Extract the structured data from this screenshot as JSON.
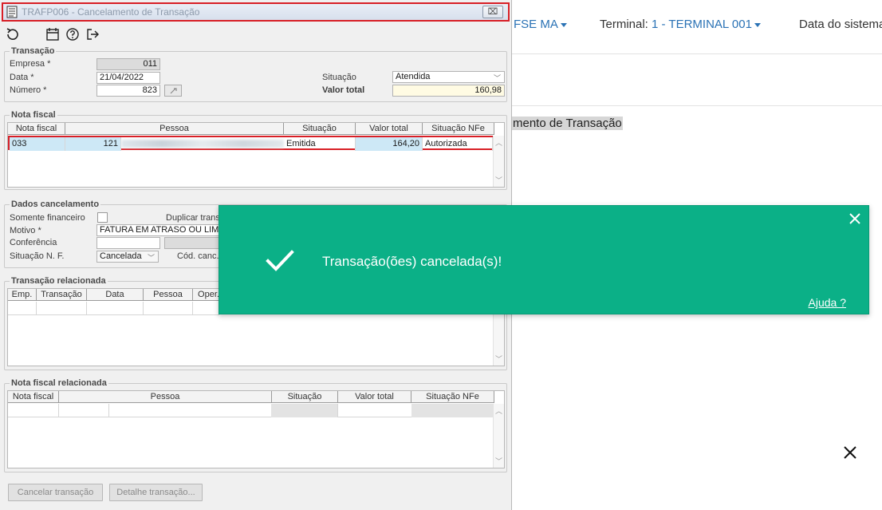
{
  "app": {
    "nav_unit": "FSE MA",
    "terminal_label": "Terminal:",
    "terminal_value": "1 - TERMINAL 001",
    "system_date_label": "Data do sistema",
    "page_title_fragment": "mento de Transação"
  },
  "window": {
    "title": "TRAFP006 - Cancelamento de Transação",
    "close_symbol": "⌧"
  },
  "transacao": {
    "group_title": "Transação",
    "empresa_label": "Empresa *",
    "empresa_value": "011",
    "data_label": "Data *",
    "data_value": "21/04/2022",
    "numero_label": "Número *",
    "numero_value": "823",
    "situacao_label": "Situação",
    "situacao_value": "Atendida",
    "valor_total_label": "Valor total",
    "valor_total_value": "160,98"
  },
  "nota_fiscal": {
    "group_title": "Nota fiscal",
    "columns": [
      "Nota fiscal",
      "Pessoa",
      "Situação",
      "Valor total",
      "Situação NFe"
    ],
    "rows": [
      {
        "nota": "033",
        "pessoa_code": "121",
        "situacao": "Emitida",
        "valor": "164,20",
        "situacao_nfe": "Autorizada"
      }
    ]
  },
  "dados_cancelamento": {
    "group_title": "Dados cancelamento",
    "somente_financeiro_label": "Somente financeiro",
    "duplicar_label": "Duplicar trans",
    "motivo_label": "Motivo *",
    "motivo_value": "FATURA EM ATRASO OU LIMITE",
    "conferencia_label": "Conferência",
    "situacao_nf_label": "Situação N. F.",
    "situacao_nf_value": "Cancelada",
    "cod_canc_label": "Cód. canc."
  },
  "transacao_relacionada": {
    "group_title": "Transação relacionada",
    "columns": [
      "Emp.",
      "Transação",
      "Data",
      "Pessoa",
      "Oper."
    ]
  },
  "nota_fiscal_relacionada": {
    "group_title": "Nota fiscal relacionada",
    "columns": [
      "Nota fiscal",
      "Pessoa",
      "Situação",
      "Valor total",
      "Situação NFe"
    ]
  },
  "buttons": {
    "cancelar": "Cancelar transação",
    "detalhe": "Detalhe transação..."
  },
  "notification": {
    "message": "Transação(ões) cancelada(s)!",
    "help_link": "Ajuda ?",
    "color": "#0bb087"
  },
  "icons": [
    "refresh-icon",
    "calendar-icon",
    "help-icon",
    "exit-icon",
    "check-icon",
    "close-icon",
    "document-icon"
  ]
}
